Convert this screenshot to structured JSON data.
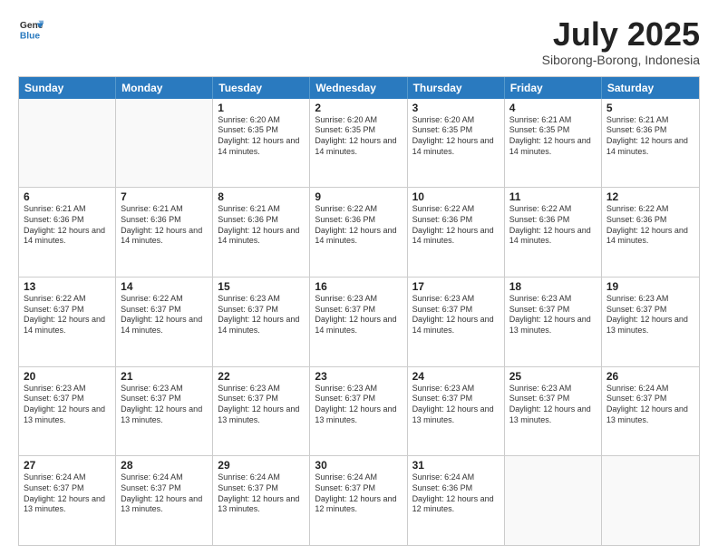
{
  "logo": {
    "text_general": "General",
    "text_blue": "Blue"
  },
  "header": {
    "month": "July 2025",
    "location": "Siborong-Borong, Indonesia"
  },
  "weekdays": [
    "Sunday",
    "Monday",
    "Tuesday",
    "Wednesday",
    "Thursday",
    "Friday",
    "Saturday"
  ],
  "rows": [
    [
      {
        "day": "",
        "info": ""
      },
      {
        "day": "",
        "info": ""
      },
      {
        "day": "1",
        "info": "Sunrise: 6:20 AM\nSunset: 6:35 PM\nDaylight: 12 hours and 14 minutes."
      },
      {
        "day": "2",
        "info": "Sunrise: 6:20 AM\nSunset: 6:35 PM\nDaylight: 12 hours and 14 minutes."
      },
      {
        "day": "3",
        "info": "Sunrise: 6:20 AM\nSunset: 6:35 PM\nDaylight: 12 hours and 14 minutes."
      },
      {
        "day": "4",
        "info": "Sunrise: 6:21 AM\nSunset: 6:35 PM\nDaylight: 12 hours and 14 minutes."
      },
      {
        "day": "5",
        "info": "Sunrise: 6:21 AM\nSunset: 6:36 PM\nDaylight: 12 hours and 14 minutes."
      }
    ],
    [
      {
        "day": "6",
        "info": "Sunrise: 6:21 AM\nSunset: 6:36 PM\nDaylight: 12 hours and 14 minutes."
      },
      {
        "day": "7",
        "info": "Sunrise: 6:21 AM\nSunset: 6:36 PM\nDaylight: 12 hours and 14 minutes."
      },
      {
        "day": "8",
        "info": "Sunrise: 6:21 AM\nSunset: 6:36 PM\nDaylight: 12 hours and 14 minutes."
      },
      {
        "day": "9",
        "info": "Sunrise: 6:22 AM\nSunset: 6:36 PM\nDaylight: 12 hours and 14 minutes."
      },
      {
        "day": "10",
        "info": "Sunrise: 6:22 AM\nSunset: 6:36 PM\nDaylight: 12 hours and 14 minutes."
      },
      {
        "day": "11",
        "info": "Sunrise: 6:22 AM\nSunset: 6:36 PM\nDaylight: 12 hours and 14 minutes."
      },
      {
        "day": "12",
        "info": "Sunrise: 6:22 AM\nSunset: 6:36 PM\nDaylight: 12 hours and 14 minutes."
      }
    ],
    [
      {
        "day": "13",
        "info": "Sunrise: 6:22 AM\nSunset: 6:37 PM\nDaylight: 12 hours and 14 minutes."
      },
      {
        "day": "14",
        "info": "Sunrise: 6:22 AM\nSunset: 6:37 PM\nDaylight: 12 hours and 14 minutes."
      },
      {
        "day": "15",
        "info": "Sunrise: 6:23 AM\nSunset: 6:37 PM\nDaylight: 12 hours and 14 minutes."
      },
      {
        "day": "16",
        "info": "Sunrise: 6:23 AM\nSunset: 6:37 PM\nDaylight: 12 hours and 14 minutes."
      },
      {
        "day": "17",
        "info": "Sunrise: 6:23 AM\nSunset: 6:37 PM\nDaylight: 12 hours and 14 minutes."
      },
      {
        "day": "18",
        "info": "Sunrise: 6:23 AM\nSunset: 6:37 PM\nDaylight: 12 hours and 13 minutes."
      },
      {
        "day": "19",
        "info": "Sunrise: 6:23 AM\nSunset: 6:37 PM\nDaylight: 12 hours and 13 minutes."
      }
    ],
    [
      {
        "day": "20",
        "info": "Sunrise: 6:23 AM\nSunset: 6:37 PM\nDaylight: 12 hours and 13 minutes."
      },
      {
        "day": "21",
        "info": "Sunrise: 6:23 AM\nSunset: 6:37 PM\nDaylight: 12 hours and 13 minutes."
      },
      {
        "day": "22",
        "info": "Sunrise: 6:23 AM\nSunset: 6:37 PM\nDaylight: 12 hours and 13 minutes."
      },
      {
        "day": "23",
        "info": "Sunrise: 6:23 AM\nSunset: 6:37 PM\nDaylight: 12 hours and 13 minutes."
      },
      {
        "day": "24",
        "info": "Sunrise: 6:23 AM\nSunset: 6:37 PM\nDaylight: 12 hours and 13 minutes."
      },
      {
        "day": "25",
        "info": "Sunrise: 6:23 AM\nSunset: 6:37 PM\nDaylight: 12 hours and 13 minutes."
      },
      {
        "day": "26",
        "info": "Sunrise: 6:24 AM\nSunset: 6:37 PM\nDaylight: 12 hours and 13 minutes."
      }
    ],
    [
      {
        "day": "27",
        "info": "Sunrise: 6:24 AM\nSunset: 6:37 PM\nDaylight: 12 hours and 13 minutes."
      },
      {
        "day": "28",
        "info": "Sunrise: 6:24 AM\nSunset: 6:37 PM\nDaylight: 12 hours and 13 minutes."
      },
      {
        "day": "29",
        "info": "Sunrise: 6:24 AM\nSunset: 6:37 PM\nDaylight: 12 hours and 13 minutes."
      },
      {
        "day": "30",
        "info": "Sunrise: 6:24 AM\nSunset: 6:37 PM\nDaylight: 12 hours and 12 minutes."
      },
      {
        "day": "31",
        "info": "Sunrise: 6:24 AM\nSunset: 6:36 PM\nDaylight: 12 hours and 12 minutes."
      },
      {
        "day": "",
        "info": ""
      },
      {
        "day": "",
        "info": ""
      }
    ]
  ]
}
